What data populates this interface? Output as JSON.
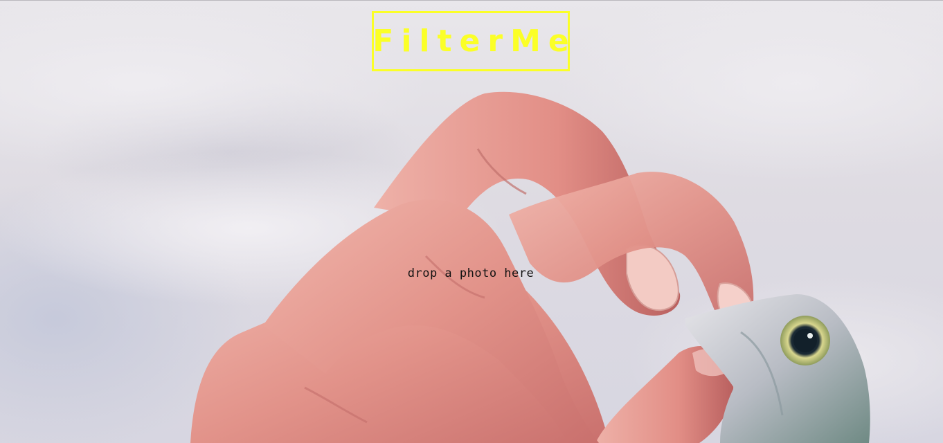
{
  "app": {
    "logo_text": "FilterMe",
    "drop_prompt": "drop a photo here"
  },
  "background_photo": {
    "subject": "hand holding a small fish against a cloudy sky",
    "icon": "photo-icon"
  },
  "colors": {
    "logo_accent": "#fbff27",
    "prompt_text": "#111111",
    "sky": "#dedbe2",
    "skin": "#e49a92"
  }
}
